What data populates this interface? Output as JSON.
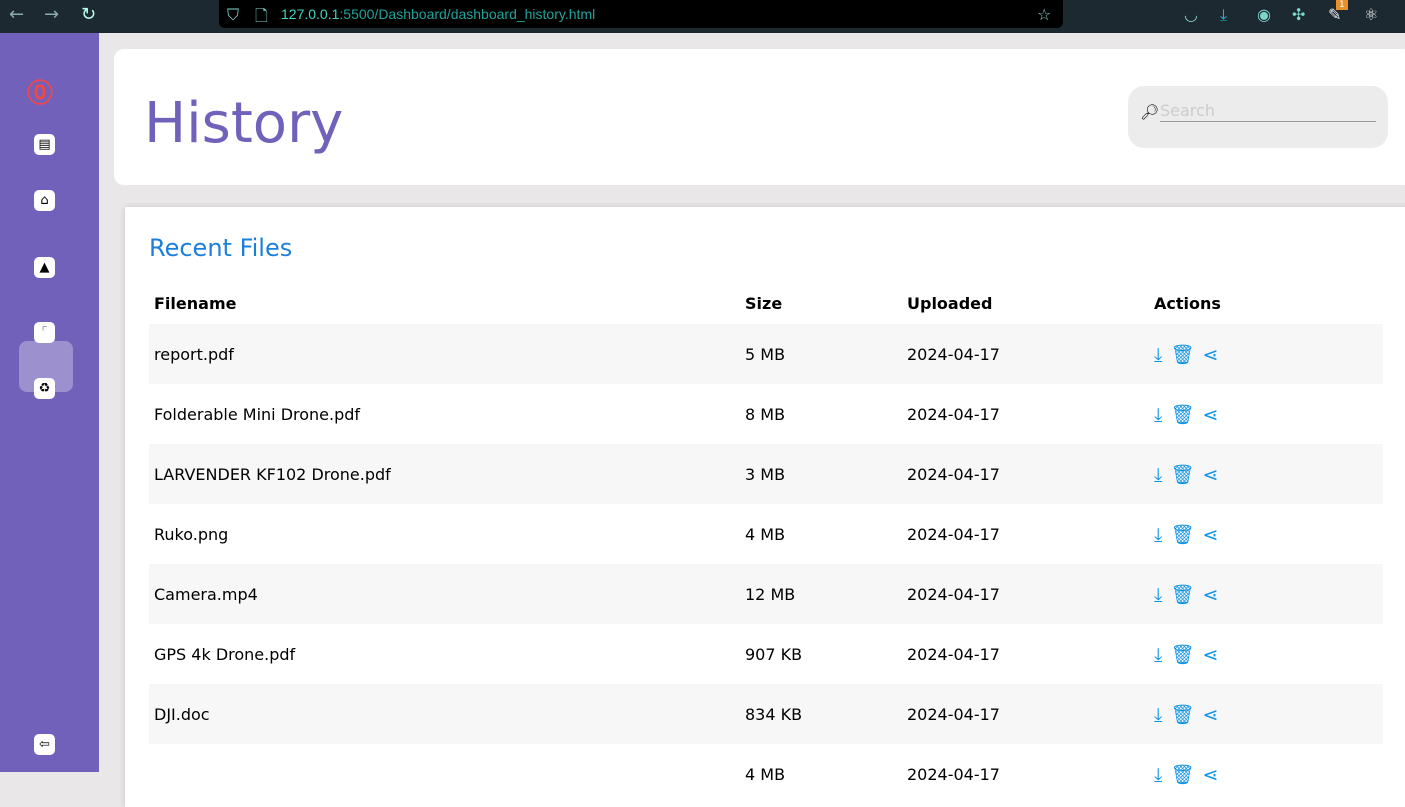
{
  "browser": {
    "url_host": "127.0.0.1",
    "url_rest": ":5500/Dashboard/dashboard_history.html",
    "badge": "1"
  },
  "sidebar": {
    "items": [
      {
        "name": "monitor"
      },
      {
        "name": "home"
      },
      {
        "name": "drive"
      },
      {
        "name": "history"
      },
      {
        "name": "recycle-bin"
      }
    ]
  },
  "header": {
    "title": "History",
    "search_placeholder": "Search"
  },
  "files": {
    "title": "Recent Files",
    "columns": [
      "Filename",
      "Size",
      "Uploaded",
      "Actions"
    ],
    "rows": [
      {
        "name": "report.pdf",
        "size": "5 MB",
        "date": "2024-04-17"
      },
      {
        "name": "Folderable Mini Drone.pdf",
        "size": "8 MB",
        "date": "2024-04-17"
      },
      {
        "name": "LARVENDER KF102 Drone.pdf",
        "size": "3 MB",
        "date": "2024-04-17"
      },
      {
        "name": "Ruko.png",
        "size": "4 MB",
        "date": "2024-04-17"
      },
      {
        "name": "Camera.mp4",
        "size": "12 MB",
        "date": "2024-04-17"
      },
      {
        "name": "GPS 4k Drone.pdf",
        "size": "907 KB",
        "date": "2024-04-17"
      },
      {
        "name": "DJI.doc",
        "size": "834 KB",
        "date": "2024-04-17"
      },
      {
        "name": "",
        "size": "4 MB",
        "date": "2024-04-17"
      }
    ]
  }
}
